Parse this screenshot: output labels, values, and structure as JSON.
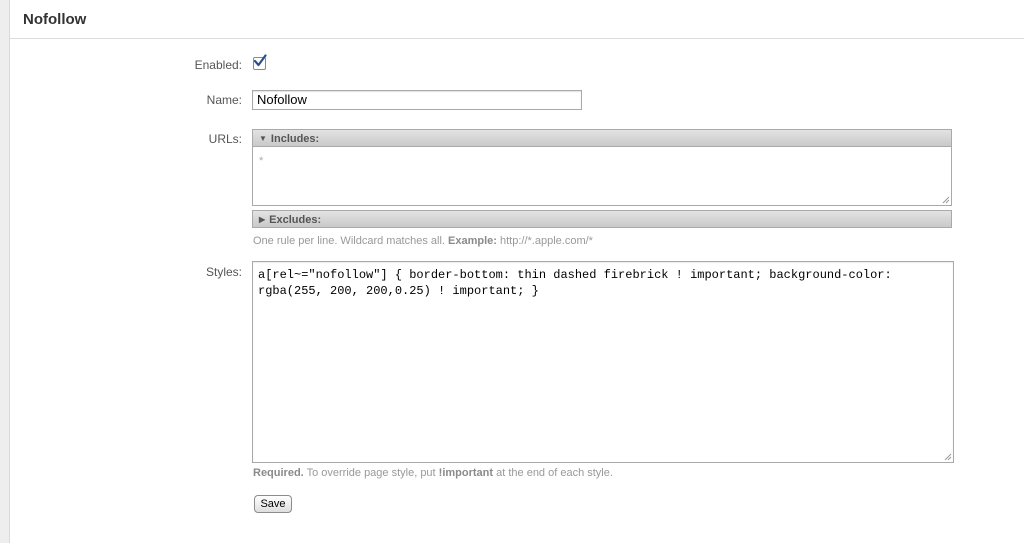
{
  "page": {
    "title": "Nofollow"
  },
  "form": {
    "enabled_label": "Enabled:",
    "enabled_checked": true,
    "name_label": "Name:",
    "name_value": "Nofollow",
    "urls_label": "URLs:",
    "includes_label": "Includes:",
    "includes_placeholder": "*",
    "excludes_label": "Excludes:",
    "urls_hint_text": "One rule per line. Wildcard matches all. ",
    "urls_hint_example_label": "Example:",
    "urls_hint_example_value": " http://*.apple.com/*",
    "styles_label": "Styles:",
    "styles_value": "a[rel~=\"nofollow\"] { border-bottom: thin dashed firebrick ! important; background-color: rgba(255, 200, 200,0.25) ! important; }",
    "styles_hint_required": "Required.",
    "styles_hint_text_1": " To override page style, put ",
    "styles_hint_important": "!important",
    "styles_hint_text_2": " at the end of each style.",
    "save_label": "Save"
  },
  "icons": {
    "checkbox": "checkmark-icon",
    "includes_toggle": "triangle-down-icon",
    "excludes_toggle": "triangle-right-icon"
  },
  "colors": {
    "checkmark": "#2a4f8f",
    "section_bar": "#d4d4d4"
  }
}
